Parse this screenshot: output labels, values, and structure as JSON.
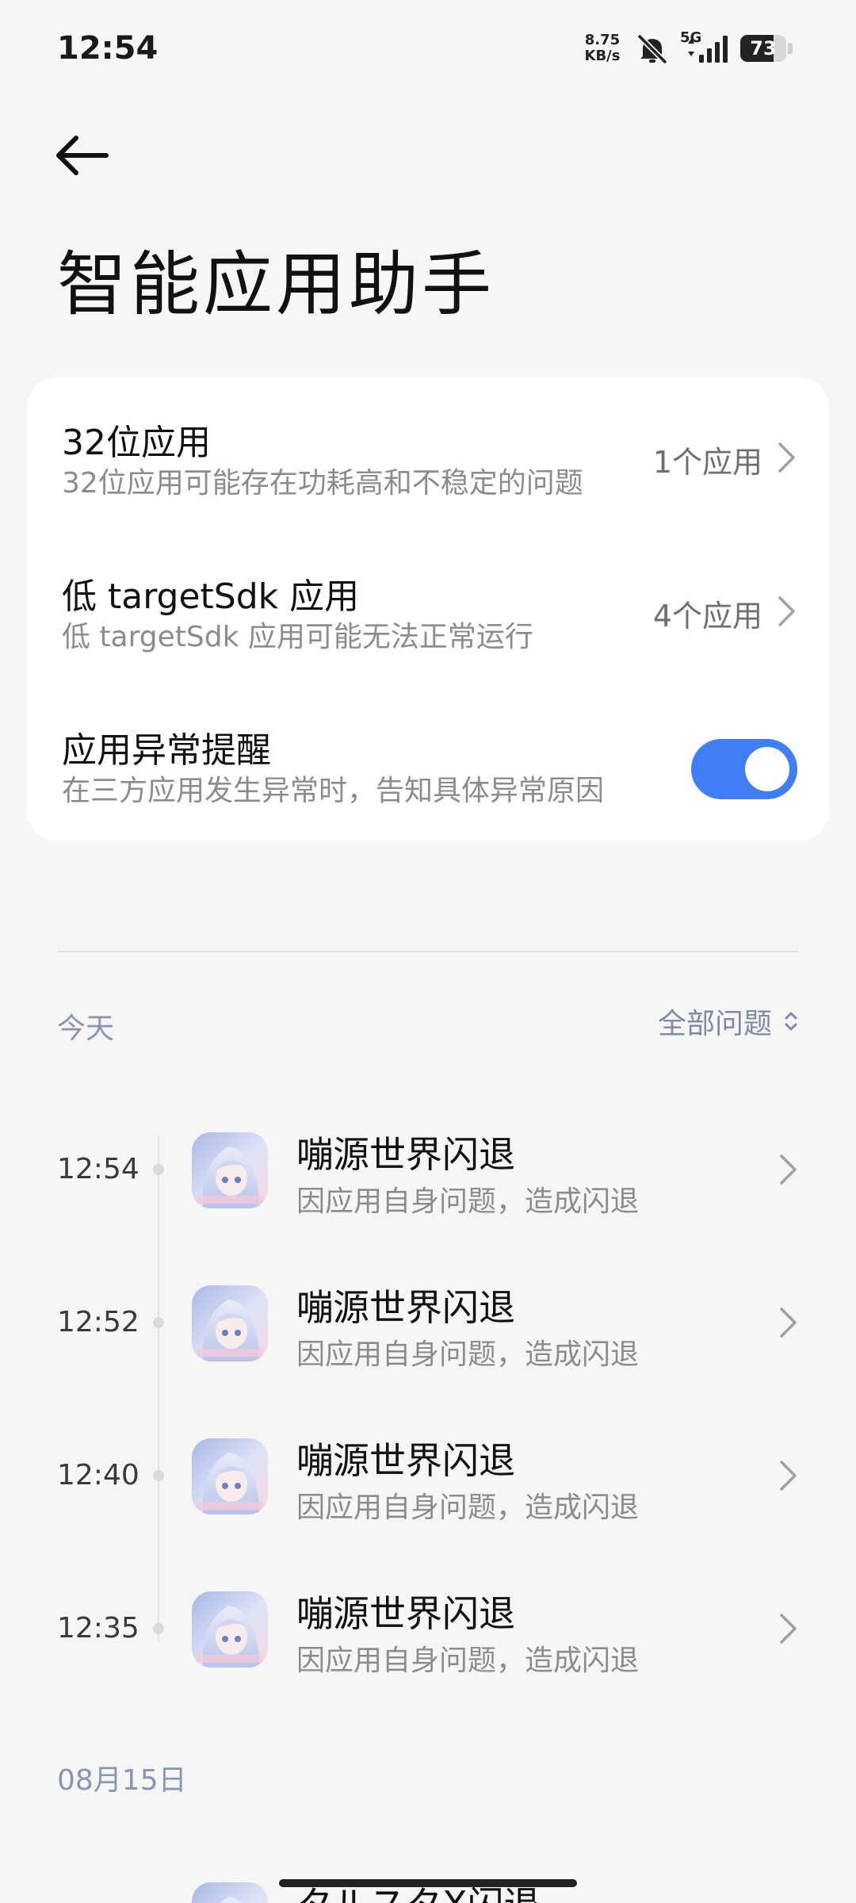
{
  "status_bar": {
    "time": "12:54",
    "net_speed_value": "8.75",
    "net_speed_unit": "KB/s",
    "network": "5G",
    "battery_level": "73",
    "battery_fraction": 0.73,
    "icons": [
      "mute-icon",
      "signal-icon",
      "battery-icon"
    ]
  },
  "header": {
    "back_icon": "arrow-left-icon",
    "title": "智能应用助手"
  },
  "settings": {
    "items": [
      {
        "title": "32位应用",
        "subtitle": "32位应用可能存在功耗高和不稳定的问题",
        "value": "1个应用"
      },
      {
        "title": "低 targetSdk 应用",
        "subtitle": "低 targetSdk 应用可能无法正常运行",
        "value": "4个应用"
      },
      {
        "title": "应用异常提醒",
        "subtitle": "在三方应用发生异常时，告知具体异常原因",
        "toggle_on": true
      }
    ]
  },
  "filter": {
    "section_label": "今天",
    "dropdown_label": "全部问题"
  },
  "issues": [
    {
      "time": "12:54",
      "title": "嘣源世界闪退",
      "description": "因应用自身问题，造成闪退"
    },
    {
      "time": "12:52",
      "title": "嘣源世界闪退",
      "description": "因应用自身问题，造成闪退"
    },
    {
      "time": "12:40",
      "title": "嘣源世界闪退",
      "description": "因应用自身问题，造成闪退"
    },
    {
      "time": "12:35",
      "title": "嘣源世界闪退",
      "description": "因应用自身问题，造成闪退"
    }
  ],
  "previous_section": {
    "date_label": "08月15日",
    "partial_title": "タルスタX闪退"
  },
  "colors": {
    "accent": "#3f7ef5",
    "section_label": "#8a95b2",
    "background": "#f6f6f7"
  }
}
